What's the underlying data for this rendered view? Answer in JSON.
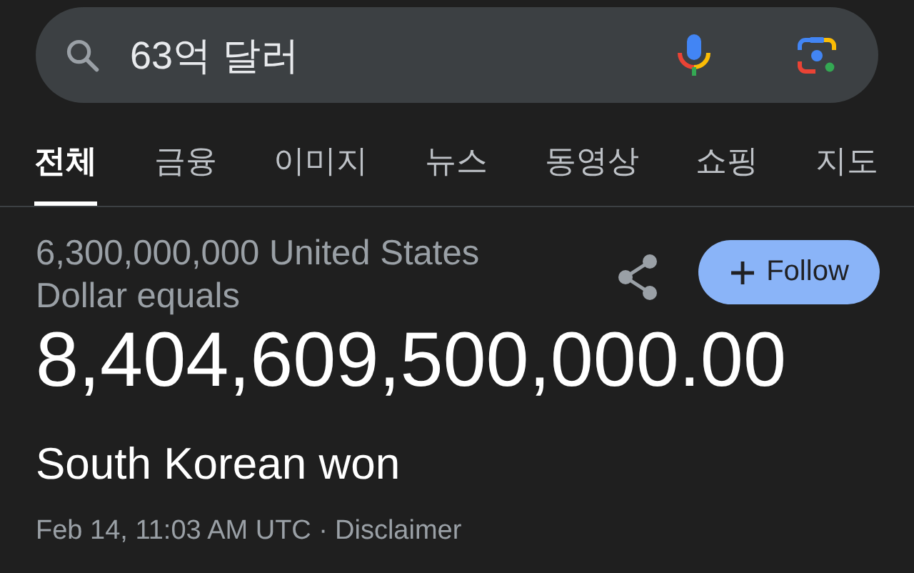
{
  "search": {
    "value": "63억 달러"
  },
  "tabs": [
    {
      "label": "전체",
      "selected": true
    },
    {
      "label": "금융",
      "selected": false
    },
    {
      "label": "이미지",
      "selected": false
    },
    {
      "label": "뉴스",
      "selected": false
    },
    {
      "label": "동영상",
      "selected": false
    },
    {
      "label": "쇼핑",
      "selected": false
    },
    {
      "label": "지도",
      "selected": false
    }
  ],
  "result": {
    "source": "6,300,000,000 United States Dollar equals",
    "amount": "8,404,609,500,000.00",
    "currency": "South Korean won",
    "follow_button": "Follow",
    "timestamp": "Feb 14, 11:03 AM UTC ·",
    "disclaimer_link": "Disclaimer"
  }
}
